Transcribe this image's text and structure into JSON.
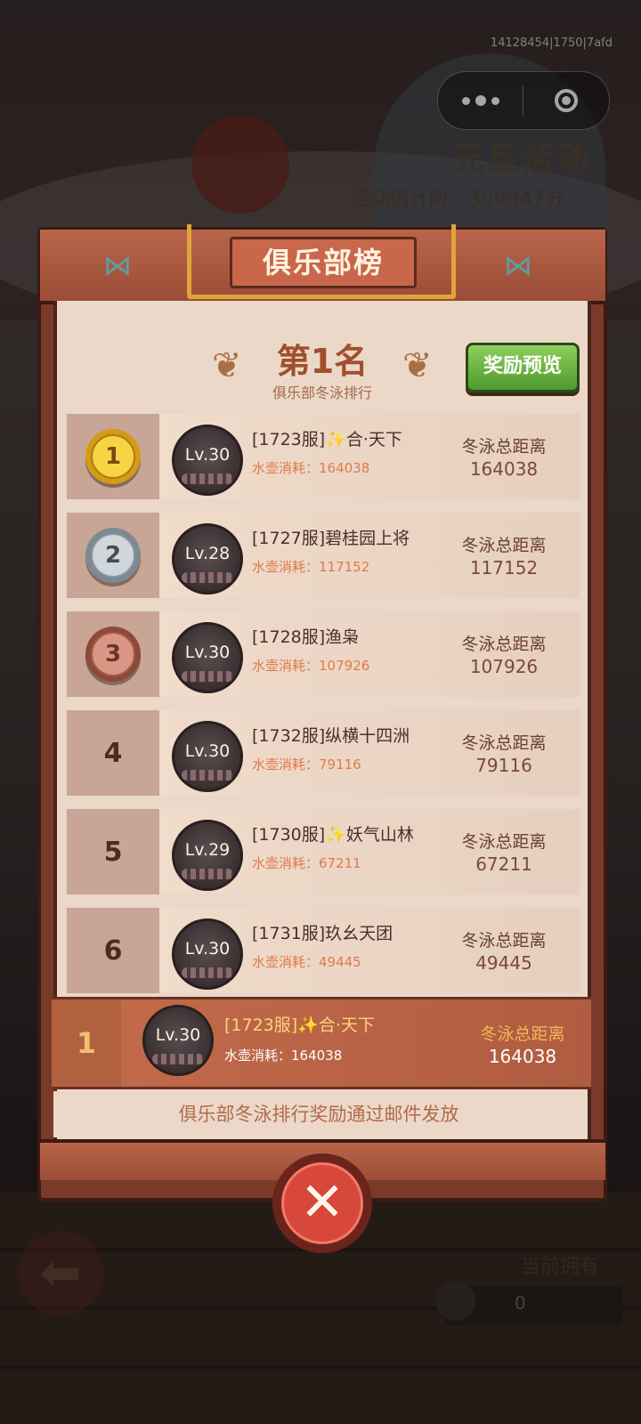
{
  "status": {
    "dev_tag": "14128454|1750|7afd"
  },
  "event": {
    "title": "元旦活动",
    "countdown": "活动倒计时：3小时47分"
  },
  "panel": {
    "title": "俱乐部榜",
    "my_rank_title": "第1名",
    "my_rank_subtitle": "俱乐部冬泳排行",
    "reward_button": "奖励预览",
    "footer_note": "俱乐部冬泳排行奖励通过邮件发放"
  },
  "rows": [
    {
      "rank": "1",
      "level": "Lv.30",
      "name": "[1723服]✨合·天下",
      "consume": "水壶消耗：164038",
      "dist_label": "冬泳总距离",
      "dist": "164038"
    },
    {
      "rank": "2",
      "level": "Lv.28",
      "name": "[1727服]碧桂园上将",
      "consume": "水壶消耗：117152",
      "dist_label": "冬泳总距离",
      "dist": "117152"
    },
    {
      "rank": "3",
      "level": "Lv.30",
      "name": "[1728服]渔枭",
      "consume": "水壶消耗：107926",
      "dist_label": "冬泳总距离",
      "dist": "107926"
    },
    {
      "rank": "4",
      "level": "Lv.30",
      "name": "[1732服]纵横十四洲",
      "consume": "水壶消耗：79116",
      "dist_label": "冬泳总距离",
      "dist": "79116"
    },
    {
      "rank": "5",
      "level": "Lv.29",
      "name": "[1730服]✨妖气山林",
      "consume": "水壶消耗：67211",
      "dist_label": "冬泳总距离",
      "dist": "67211"
    },
    {
      "rank": "6",
      "level": "Lv.30",
      "name": "[1731服]玖幺天团",
      "consume": "水壶消耗：49445",
      "dist_label": "冬泳总距离",
      "dist": "49445"
    }
  ],
  "my_row": {
    "rank": "1",
    "level": "Lv.30",
    "name": "[1723服]✨合·天下",
    "consume": "水壶消耗：164038",
    "dist_label": "冬泳总距离",
    "dist": "164038"
  },
  "bottom": {
    "owned_label": "当前拥有",
    "owned_value": "0"
  },
  "icons": {
    "back": "back-arrow-icon",
    "close": "close-x-icon",
    "fish": "fish-icon",
    "laurel": "laurel-icon",
    "more": "more-dots-icon",
    "capsule_close": "target-icon"
  },
  "colors": {
    "frame": "#7a3a28",
    "inner": "#ecd8c8",
    "reward_green": "#4f9a2f",
    "gold": "#f6d443",
    "close_red": "#d8483a"
  }
}
